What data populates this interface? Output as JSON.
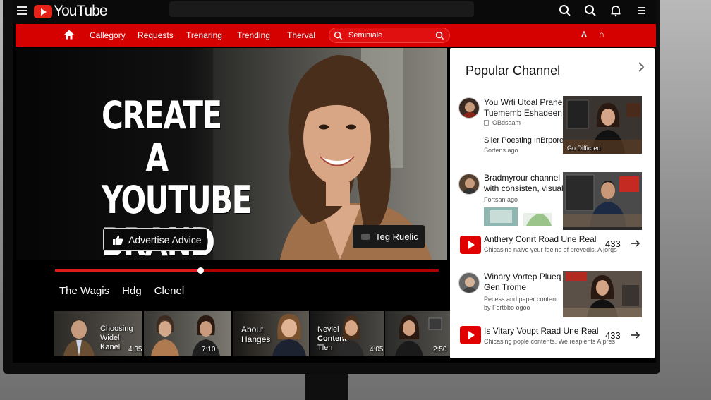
{
  "topbar": {
    "logo_text": "YouTube",
    "icons": [
      "menu-icon",
      "search-icon",
      "search-icon",
      "bell-icon",
      "menu-icon"
    ]
  },
  "nav": {
    "items": [
      "Callegory",
      "Requests",
      "Trenaring",
      "Trending",
      "Therval"
    ],
    "search_text": "Seminiale",
    "right_a": "A",
    "right_b": "∩"
  },
  "hero": {
    "title_lines": [
      "CREATE A",
      "YOUTUBE",
      "BRAND"
    ],
    "cta_label": "Advertise Advice",
    "badge_label": "Teg Ruelic"
  },
  "progress": {
    "value": 0.38
  },
  "sub_tabs": [
    "The Wagis",
    "Hdg",
    "Clenel"
  ],
  "thumbnails": [
    {
      "label_lines": [
        "Choosing",
        "Widel",
        "Kanel"
      ],
      "duration": "4:35"
    },
    {
      "label_lines": [],
      "duration": "7:10"
    },
    {
      "label_lines": [
        "About",
        "Hanges"
      ],
      "duration": ""
    },
    {
      "label_lines": [
        "Neviel",
        "Content",
        "Tlen"
      ],
      "duration": "4:05"
    },
    {
      "label_lines": [],
      "duration": "2:50"
    }
  ],
  "panel": {
    "title": "Popular Channel",
    "items": [
      {
        "title_lines": [
          "You Wrti Utoal Pranel",
          "Tuememb Eshadeen"
        ],
        "channel": "OBdsaam",
        "sub_title": "Siler Poesting InBrpores",
        "time": "Sortens ago",
        "thumb_caption": "Go Difficred"
      },
      {
        "title_lines": [
          "Bradmyrour channel",
          "with consisten, visuals"
        ],
        "time": "Fortsan ago"
      },
      {
        "title": "Anthery Conrt Road Une Real",
        "sub": "Chicasing naive yeur foeins of prevedls. A jorgs",
        "count": "433"
      },
      {
        "title_lines": [
          "Winary Vortep Plueq",
          "Gen Trome"
        ],
        "sub_lines": [
          "Pecess and paper content",
          "by Fortbbo ogoo"
        ]
      },
      {
        "title": "Is Vitary Voupt Raad Une Real",
        "sub": "Chicasing pople contents. We reapients A pres",
        "count": "433"
      }
    ]
  }
}
